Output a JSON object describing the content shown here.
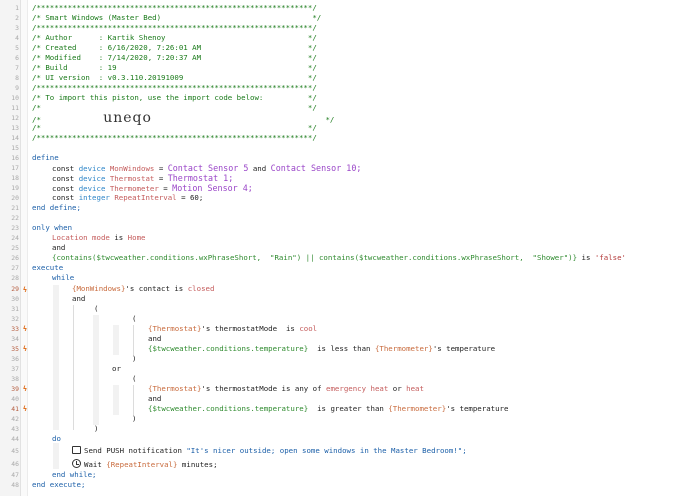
{
  "line_numbers": [
    "1",
    "2",
    "3",
    "4",
    "5",
    "6",
    "7",
    "8",
    "9",
    "10",
    "11",
    "12",
    "13",
    "14",
    "15",
    "16",
    "17",
    "18",
    "19",
    "20",
    "21",
    "22",
    "23",
    "24",
    "25",
    "26",
    "27",
    "28",
    "29",
    "30",
    "31",
    "32",
    "33",
    "34",
    "35",
    "36",
    "37",
    "38",
    "39",
    "40",
    "41",
    "42",
    "43",
    "44",
    "45",
    "46",
    "47",
    "48",
    "49"
  ],
  "header": {
    "border": "/**************************************************************/",
    "border2": "/**************************************************************/",
    "border3": "/**************************************************************/",
    "border4": "/**************************************************************/",
    "title": "/* Smart Windows (Master Bed)                                  */",
    "author": "/* Author      : Kartik Shenoy                                */",
    "created": "/* Created     : 6/16/2020, 7:26:01 AM                        */",
    "modified": "/* Modified    : 7/14/2020, 7:20:37 AM                        */",
    "build": "/* Build       : 19                                           */",
    "ui_version": "/* UI version  : v0.3.110.20191009                            */",
    "import_note": "/* To import this piston, use the import code below:          */",
    "blank_a": "/*                                                            */",
    "code_prefix": "/*              ",
    "import_code": "uneqo",
    "code_suffix": "                                       */",
    "blank_b": "/*                                                            */"
  },
  "define": {
    "kw_define": "define",
    "kw_const": "const",
    "kw_device": "device",
    "kw_integer": "integer",
    "kw_and": "and",
    "eq": "=",
    "var_windows": "MonWindows",
    "var_thermostat": "Thermostat",
    "var_thermometer": "Thermometer",
    "var_repeat": "RepeatInterval",
    "dev_contact5": "Contact Sensor 5",
    "dev_contact10": "Contact Sensor 10;",
    "dev_thermostat": "Thermostat 1;",
    "dev_motion": "Motion Sensor 4;",
    "repeat_value": "60;",
    "end_define": "end define;"
  },
  "only_when": {
    "kw": "only when",
    "location_mode": "Location mode",
    "is": "is",
    "home": "Home",
    "and": "and",
    "expr_contains1": "{contains($twcweather.conditions.wxPhraseShort,  \"Rain\") || contains($twcweather.conditions.wxPhraseShort,  \"Shower\")}",
    "is_str": "is",
    "false_str": "'false'"
  },
  "execute": {
    "kw_execute": "execute",
    "kw_while": "while",
    "windows_ref": "{MonWindows}",
    "contact_text": "'s contact is",
    "closed": "closed",
    "and": "and",
    "open_paren": "(",
    "close_paren": ")",
    "or": "or",
    "thermostat_ref": "{Thermostat}",
    "thermostat_mode": "'s thermostatMode",
    "is_cool": "is",
    "cool": "cool",
    "temp_expr": "{$twcweather.conditions.temperature}",
    "less_than": "is less than",
    "thermometer_ref": "{Thermometer}",
    "temperature_text": "'s temperature",
    "is_any_of": "is any of",
    "emergency_heat": "emergency heat",
    "or_word": "or",
    "heat": "heat",
    "greater_than": "is greater than",
    "kw_do": "do",
    "push_label": "Send PUSH notification",
    "push_message": "\"It's nicer outside; open some windows in the Master Bedroom!\";",
    "wait_label": "Wait",
    "wait_value": "{RepeatInterval}",
    "minutes": "minutes;",
    "end_while": "end while;",
    "end_execute": "end execute;"
  },
  "colors": {
    "comment": "#1a7a1a",
    "keyword": "#1b5fa8",
    "device": "#9a46c8",
    "variable": "#c45b5b",
    "flag": "#e0701e"
  },
  "icons": [
    "lightning-flag-icon",
    "message-bubble-icon",
    "clock-icon"
  ]
}
